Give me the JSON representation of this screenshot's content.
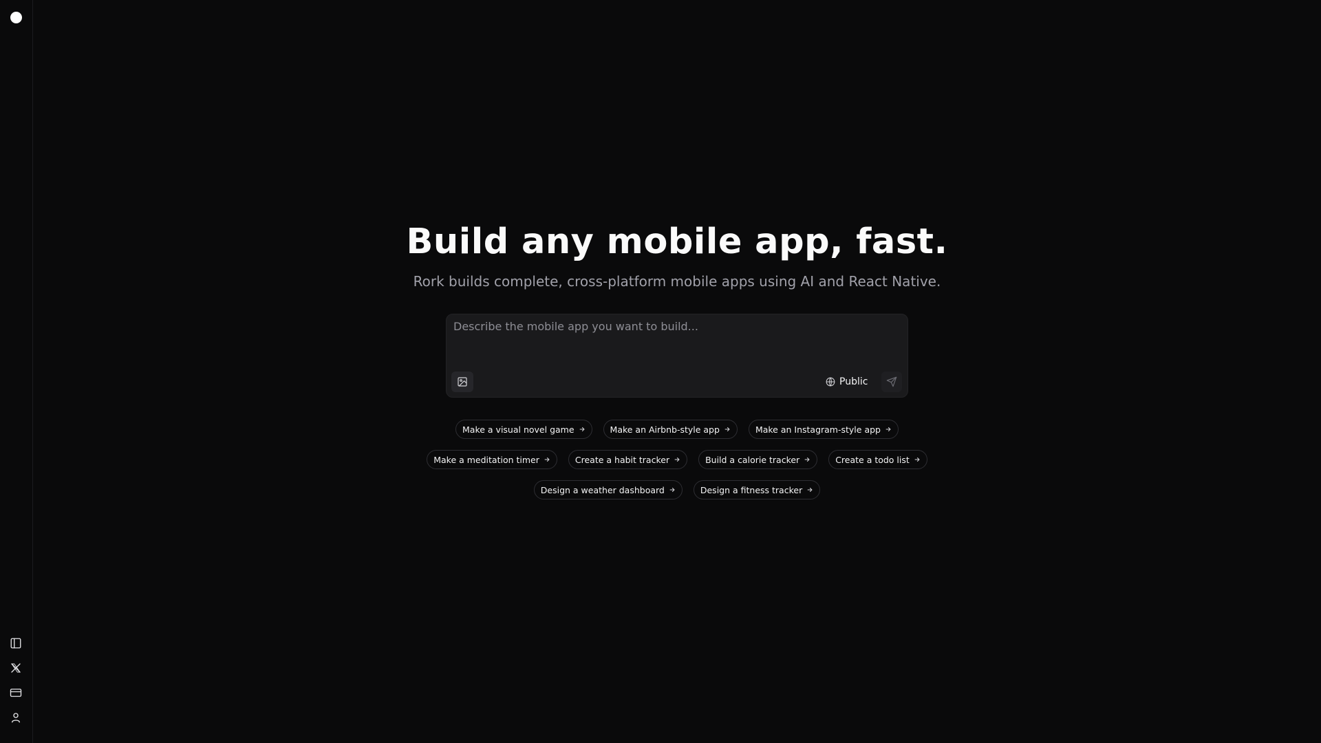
{
  "sidebar": {
    "logo": "logo-circle",
    "bottom_icons": [
      "sidebar-toggle-icon",
      "x-logo-icon",
      "credit-card-icon",
      "user-icon"
    ]
  },
  "hero": {
    "title": "Build any mobile app, fast.",
    "subtitle": "Rork builds complete, cross-platform mobile apps using AI and React Native."
  },
  "composer": {
    "placeholder": "Describe the mobile app you want to build...",
    "value": "",
    "visibility_label": "Public",
    "icons": [
      "image-icon",
      "globe-icon",
      "send-icon"
    ]
  },
  "suggestions": {
    "row1": [
      "Make a visual novel game",
      "Make an Airbnb-style app",
      "Make an Instagram-style app"
    ],
    "row2": [
      "Make a meditation timer",
      "Create a habit tracker",
      "Build a calorie tracker",
      "Create a todo list"
    ],
    "row3": [
      "Design a weather dashboard",
      "Design a fitness tracker"
    ]
  },
  "colors": {
    "background": "#0a0a0b",
    "panel": "#1a1a1c",
    "muted_text": "#a1a1aa",
    "text": "#fafafa"
  }
}
